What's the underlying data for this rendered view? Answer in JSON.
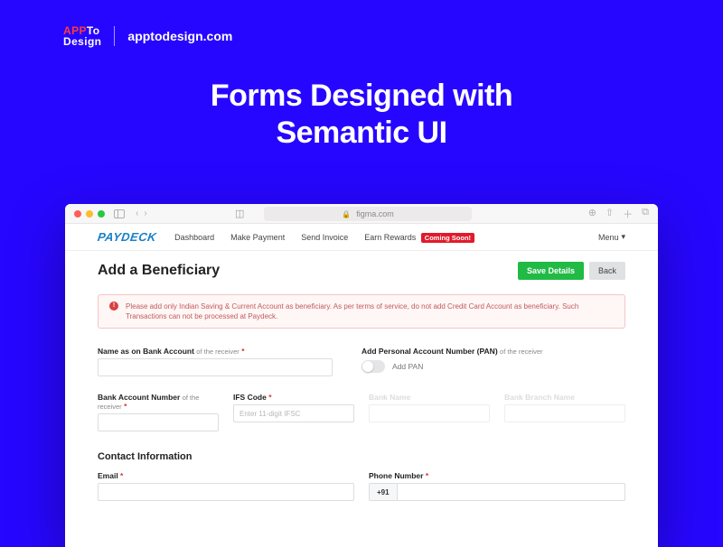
{
  "site_header": {
    "logo_top_a": "APP",
    "logo_top_b": "To",
    "logo_bottom": "Design",
    "domain": "apptodesign.com"
  },
  "hero": {
    "line1": "Forms Designed with",
    "line2": "Semantic UI"
  },
  "browser": {
    "url": "figma.com"
  },
  "app": {
    "brand": "PAYDECK",
    "nav": {
      "dashboard": "Dashboard",
      "make_payment": "Make Payment",
      "send_invoice": "Send Invoice",
      "earn_rewards": "Earn Rewards",
      "coming_soon": "Coming Soon!",
      "menu": "Menu"
    },
    "title": "Add a Beneficiary",
    "actions": {
      "save": "Save Details",
      "back": "Back"
    },
    "alert": "Please add only Indian Saving & Current Account as beneficiary. As per terms of service, do not add Credit Card Account as beneficiary. Such Transactions can not be processed at Paydeck.",
    "fields": {
      "name_label": "Name as on Bank Account",
      "name_sub": "of the receiver",
      "pan_label": "Add Personal Account Number (PAN)",
      "pan_sub": "of the receiver",
      "pan_toggle_label": "Add PAN",
      "account_label": "Bank Account Number",
      "account_sub": "of the receiver",
      "ifs_label": "IFS Code",
      "ifs_placeholder": "Enter 11-digit IFSC",
      "bank_name_label": "Bank Name",
      "bank_branch_label": "Bank Branch Name",
      "contact_section": "Contact Information",
      "email_label": "Email",
      "phone_label": "Phone Number",
      "phone_prefix": "+91"
    }
  }
}
